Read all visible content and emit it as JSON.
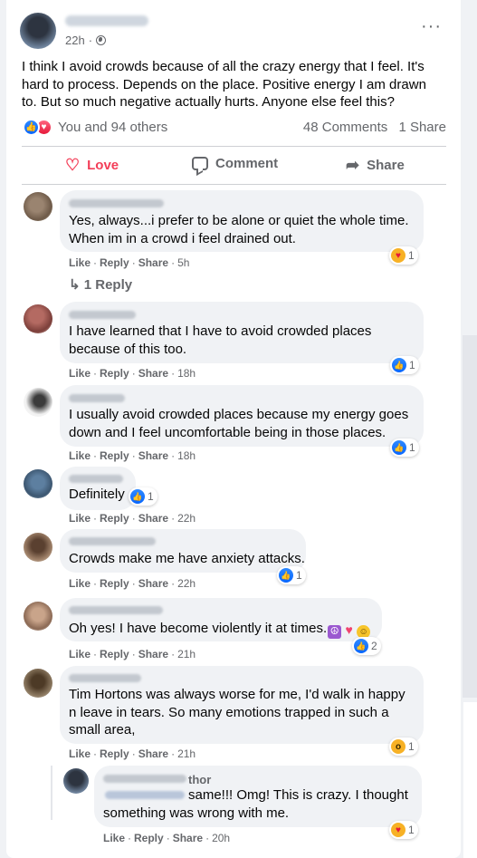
{
  "post": {
    "author": "Teri Plasurre",
    "time": "22h",
    "privacy_icon": "globe-icon",
    "text": "I think I avoid crowds because of all the crazy energy that I feel. It's hard to process. Depends on the place. Positive energy I am drawn to. But so much negative actually hurts. Anyone else feel this?",
    "reactions_text": "You and 94 others",
    "comments_count": "48 Comments",
    "shares_count": "1 Share"
  },
  "actions": {
    "love": "Love",
    "comment": "Comment",
    "share": "Share"
  },
  "comment_actions": {
    "like": "Like",
    "reply": "Reply",
    "share": "Share",
    "sep": "·"
  },
  "comments": [
    {
      "name": "Janet E. Ottelberle",
      "line1": "Yes, always...i prefer to be alone or quiet the whole time.",
      "line2": "When im in a crowd i feel drained out.",
      "time": "5h",
      "reaction_icon": "care",
      "reaction_count": "1",
      "replies_label": "1 Reply"
    },
    {
      "name": "Lilly Masson",
      "line1": "I have learned that I have to avoid crowded places",
      "line2": "because of this too.",
      "time": "18h",
      "reaction_icon": "like",
      "reaction_count": "1"
    },
    {
      "name": "Mimi Mieser",
      "line1": "I usually avoid crowded places because my energy goes",
      "line2": "down and I feel uncomfortable being in those places.",
      "time": "18h",
      "reaction_icon": "like",
      "reaction_count": "1"
    },
    {
      "name": "Mo Cresse",
      "line1": "Definitely",
      "time": "22h",
      "reaction_icon": "like",
      "reaction_count": "1"
    },
    {
      "name": "Alisha Maddox",
      "line1": "Crowds make me have anxiety attacks.",
      "time": "22h",
      "reaction_icon": "like",
      "reaction_count": "1"
    },
    {
      "name": "Jeanette Kurbardo",
      "line1": "Oh yes! I have become violently it at times.",
      "emoji": [
        "peace",
        "heart",
        "smile"
      ],
      "time": "21h",
      "reaction_icon": "like-love",
      "reaction_count": "2"
    },
    {
      "name": "Kimberly Goff",
      "line1": "Tim Hortons was always worse for me, I'd walk in happy",
      "line2": "n leave in tears. So many emotions trapped in such a",
      "line3": "small area,",
      "time": "21h",
      "reaction_icon": "wow",
      "reaction_count": "1"
    }
  ],
  "reply": {
    "name": "Teri Plasurre",
    "author_badge": "thor",
    "mention": "Kimberly Goff",
    "line1": "same!!! Omg! This is crazy. I thought",
    "line2": "something was wrong with me.",
    "time": "20h",
    "reaction_icon": "care",
    "reaction_count": "1"
  }
}
